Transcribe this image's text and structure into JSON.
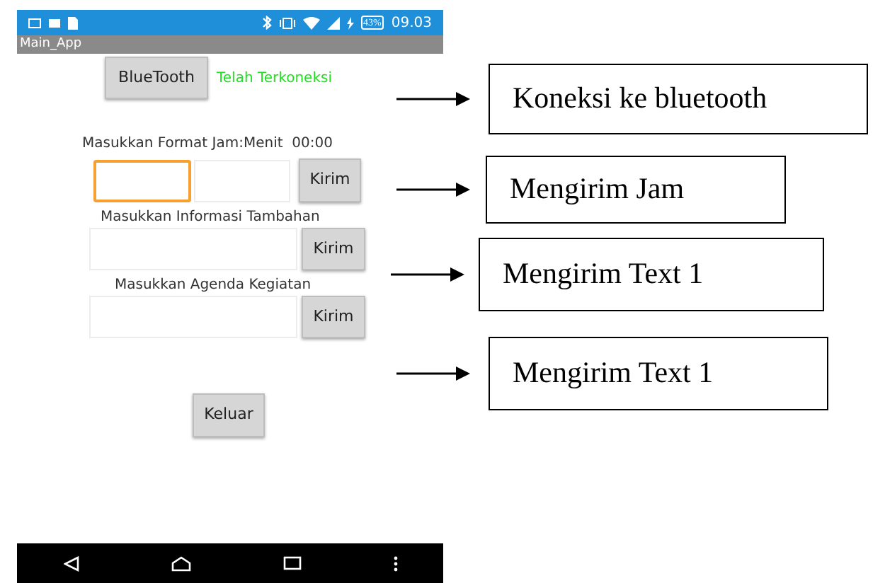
{
  "status_bar": {
    "battery": "43%",
    "time": "09.03"
  },
  "app_title": "Main_App",
  "bluetooth": {
    "button": "BlueTooth",
    "status": "Telah Terkoneksi"
  },
  "time_form": {
    "label": "Masukkan Format Jam:Menit  00:00",
    "fields": [
      {
        "focused": true
      },
      {
        "focused": false
      }
    ],
    "button": "Kirim"
  },
  "forms": [
    {
      "label": "Masukkan Informasi Tambahan",
      "button": "Kirim"
    },
    {
      "label": "Masukkan Agenda Kegiatan",
      "button": "Kirim"
    }
  ],
  "exit_button": "Keluar",
  "annotations": [
    "Koneksi ke bluetooth",
    "Mengirim Jam",
    "Mengirim Text 1",
    "Mengirim Text 1"
  ]
}
